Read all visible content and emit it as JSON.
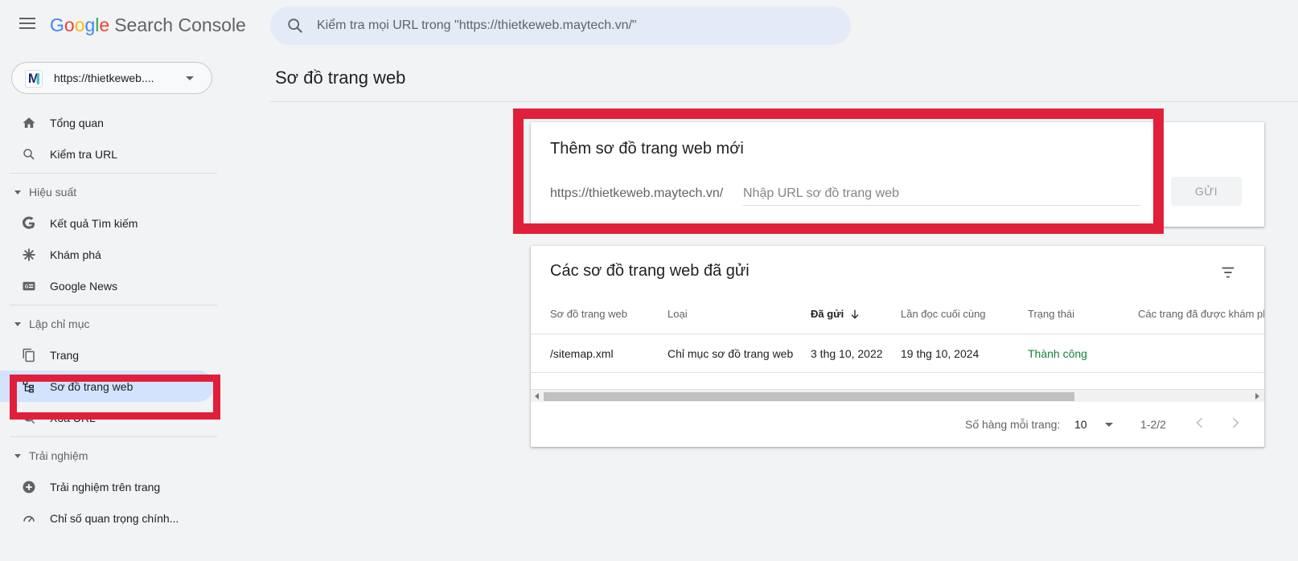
{
  "header": {
    "logo_google": [
      "G",
      "o",
      "o",
      "g",
      "l",
      "e"
    ],
    "logo_product": "Search Console",
    "search_placeholder": "Kiểm tra mọi URL trong \"https://thietkeweb.maytech.vn/\""
  },
  "property": {
    "url": "https://thietkeweb....",
    "logo_letter": "M"
  },
  "sidebar": {
    "items_top": [
      {
        "label": "Tổng quan",
        "icon": "home-icon"
      },
      {
        "label": "Kiểm tra URL",
        "icon": "search-icon"
      }
    ],
    "section_performance": "Hiệu suất",
    "items_performance": [
      {
        "label": "Kết quả Tìm kiếm",
        "icon": "google-g-icon"
      },
      {
        "label": "Khám phá",
        "icon": "asterisk-icon"
      },
      {
        "label": "Google News",
        "icon": "news-icon"
      }
    ],
    "section_indexing": "Lập chỉ mục",
    "items_indexing": [
      {
        "label": "Trang",
        "icon": "pages-icon"
      },
      {
        "label": "Sơ đồ trang web",
        "icon": "sitemap-icon",
        "active": true
      },
      {
        "label": "Xóa URL",
        "icon": "eye-off-icon"
      }
    ],
    "section_experience": "Trải nghiệm",
    "items_experience": [
      {
        "label": "Trải nghiệm trên trang",
        "icon": "plus-circle-icon"
      },
      {
        "label": "Chỉ số quan trọng chính...",
        "icon": "gauge-icon"
      }
    ]
  },
  "main": {
    "page_title": "Sơ đồ trang web",
    "add_card": {
      "title": "Thêm sơ đồ trang web mới",
      "prefix": "https://thietkeweb.maytech.vn/",
      "input_placeholder": "Nhập URL sơ đồ trang web",
      "input_value": "",
      "submit_label": "GỬI"
    },
    "list_card": {
      "title": "Các sơ đồ trang web đã gửi",
      "columns": [
        "Sơ đồ trang web",
        "Loại",
        "Đã gửi",
        "Lần đọc cuối cùng",
        "Trạng thái",
        "Các trang đã được khám phá"
      ],
      "sorted_column": "Đã gửi",
      "sort_direction": "descending",
      "rows": [
        {
          "sitemap": "/sitemap.xml",
          "type": "Chỉ mục sơ đồ trang web",
          "submitted": "3 thg 10, 2022",
          "last_read": "19 thg 10, 2024",
          "status": "Thành công",
          "discovered_pages": ""
        }
      ],
      "pagination": {
        "rows_per_page_label": "Số hàng mỗi trang:",
        "rows_per_page": "10",
        "range": "1-2/2"
      }
    }
  },
  "colors": {
    "highlight_red": "#e0203a",
    "active_nav_bg": "#d3e3fd",
    "success_green": "#188038",
    "search_bg": "#e4ebf7"
  }
}
